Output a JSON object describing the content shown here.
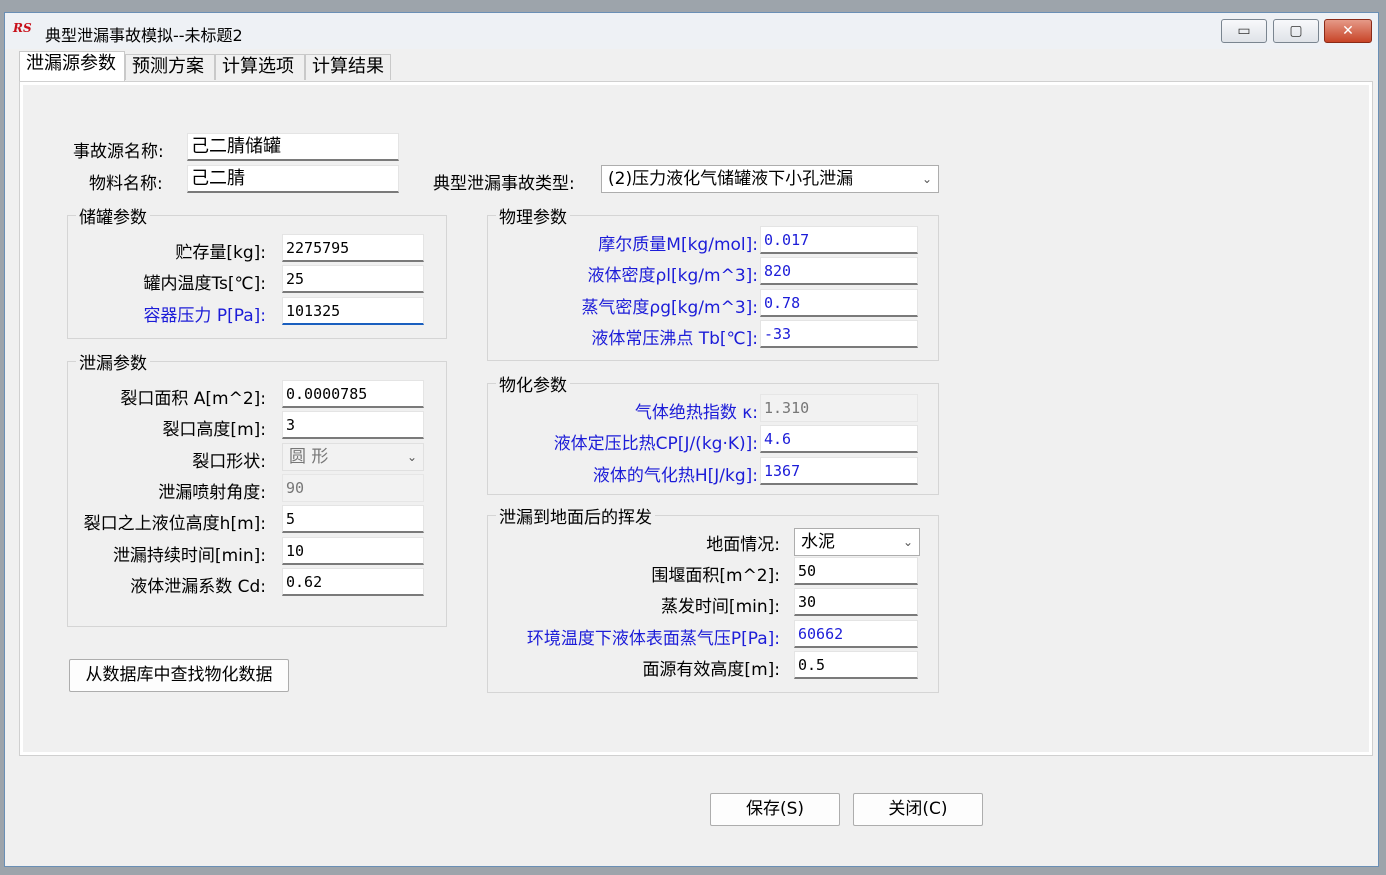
{
  "window": {
    "title": "典型泄漏事故模拟--未标题2",
    "icon": "RS",
    "minimize_glyph": "▭",
    "restore_glyph": "▢",
    "close_glyph": "✕"
  },
  "tabs": [
    "泄漏源参数",
    "预测方案",
    "计算选项",
    "计算结果"
  ],
  "header": {
    "source_label": "事故源名称:",
    "source_value": "己二腈储罐",
    "material_label": "物料名称:",
    "material_value": "己二腈",
    "type_label": "典型泄漏事故类型:",
    "type_value": "(2)压力液化气储罐液下小孔泄漏"
  },
  "tank": {
    "title": "储罐参数",
    "fields": [
      {
        "label": "贮存量[kg]:",
        "value": "2275795"
      },
      {
        "label": "罐内温度Ts[℃]:",
        "value": "25"
      },
      {
        "label": "容器压力 P[Pa]:",
        "value": "101325"
      }
    ]
  },
  "leak": {
    "title": "泄漏参数",
    "area_label": "裂口面积 A[m^2]:",
    "area_value": "0.0000785",
    "height_label": "裂口高度[m]:",
    "height_value": "3",
    "shape_label": "裂口形状:",
    "shape_value": "圆 形",
    "angle_label": "泄漏喷射角度:",
    "angle_value": "90",
    "level_label": "裂口之上液位高度h[m]:",
    "level_value": "5",
    "duration_label": "泄漏持续时间[min]:",
    "duration_value": "10",
    "coef_label": "液体泄漏系数 Cd:",
    "coef_value": "0.62"
  },
  "physical": {
    "title": "物理参数",
    "fields": [
      {
        "label": "摩尔质量M[kg/mol]:",
        "value": "0.017"
      },
      {
        "label": "液体密度ρl[kg/m^3]:",
        "value": "820"
      },
      {
        "label": "蒸气密度ρg[kg/m^3]:",
        "value": "0.78"
      },
      {
        "label": "液体常压沸点 Tb[℃]:",
        "value": "-33"
      }
    ]
  },
  "chemical": {
    "title": "物化参数",
    "fields": [
      {
        "label": "气体绝热指数 κ:",
        "value": "1.310"
      },
      {
        "label": "液体定压比热CP[J/(kg·K)]:",
        "value": "4.6"
      },
      {
        "label": "液体的气化热H[J/kg]:",
        "value": "1367"
      }
    ]
  },
  "evap": {
    "title": "泄漏到地面后的挥发",
    "ground_label": "地面情况:",
    "ground_value": "水泥",
    "dike_label": "围堰面积[m^2]:",
    "dike_value": "50",
    "time_label": "蒸发时间[min]:",
    "time_value": "30",
    "vapor_label": "环境温度下液体表面蒸气压P[Pa]:",
    "vapor_value": "60662",
    "height_label": "面源有效高度[m]:",
    "height_value": "0.5"
  },
  "buttons": {
    "lookup": "从数据库中查找物化数据",
    "save": "保存(S)",
    "close": "关闭(C)"
  }
}
